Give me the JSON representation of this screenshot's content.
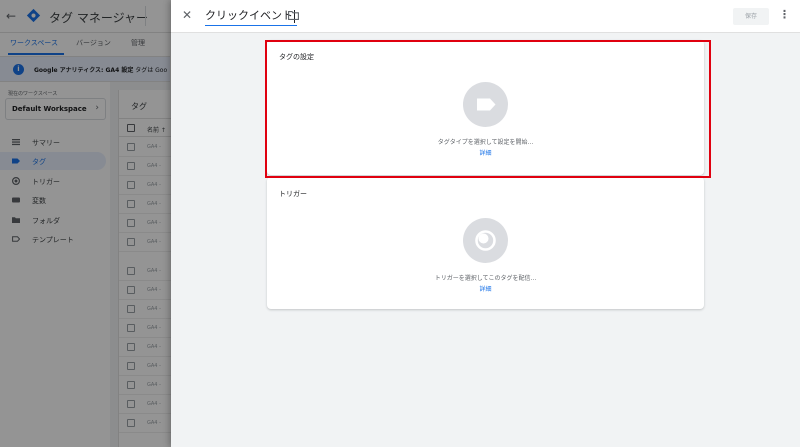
{
  "app": {
    "title": "タグ マネージャー",
    "tabs": [
      "ワークスペース",
      "バージョン",
      "管理"
    ],
    "banner": {
      "bold": "Google アナリティクス: GA4 設定",
      "text": " タグは Goo"
    },
    "workspace_label": "現在のワークスペース",
    "workspace_name": "Default Workspace",
    "nav": [
      {
        "label": "サマリー",
        "icon": "summary-icon",
        "active": false
      },
      {
        "label": "タグ",
        "icon": "tag-icon",
        "active": true
      },
      {
        "label": "トリガー",
        "icon": "trigger-icon",
        "active": false
      },
      {
        "label": "変数",
        "icon": "variable-icon",
        "active": false
      },
      {
        "label": "フォルダ",
        "icon": "folder-icon",
        "active": false
      },
      {
        "label": "テンプレート",
        "icon": "template-icon",
        "active": false
      }
    ],
    "tags_list": {
      "title": "タグ",
      "column_name": "名前 ↑",
      "rows": [
        "GA4 -",
        "GA4 -",
        "GA4 -",
        "GA4 -",
        "GA4 -",
        "GA4 -",
        "GA4 -",
        "GA4 -",
        "GA4 -",
        "GA4 -",
        "GA4 -",
        "GA4 -",
        "GA4 -",
        "GA4 -",
        "GA4 -",
        "GA4 -",
        "GA4 -"
      ]
    }
  },
  "panel": {
    "tag_name": "クリックイベント",
    "save_label": "保存",
    "tag_config": {
      "title": "タグの設定",
      "hint": "タグタイプを選択して設定を開始...",
      "link": "詳細"
    },
    "trigger": {
      "title": "トリガー",
      "hint": "トリガーを選択してこのタグを配信...",
      "link": "詳細"
    }
  },
  "colors": {
    "accent": "#1a73e8",
    "highlight": "#e0000f",
    "panel_bg": "#f1f3f4",
    "icon_circle": "#dadce0"
  }
}
